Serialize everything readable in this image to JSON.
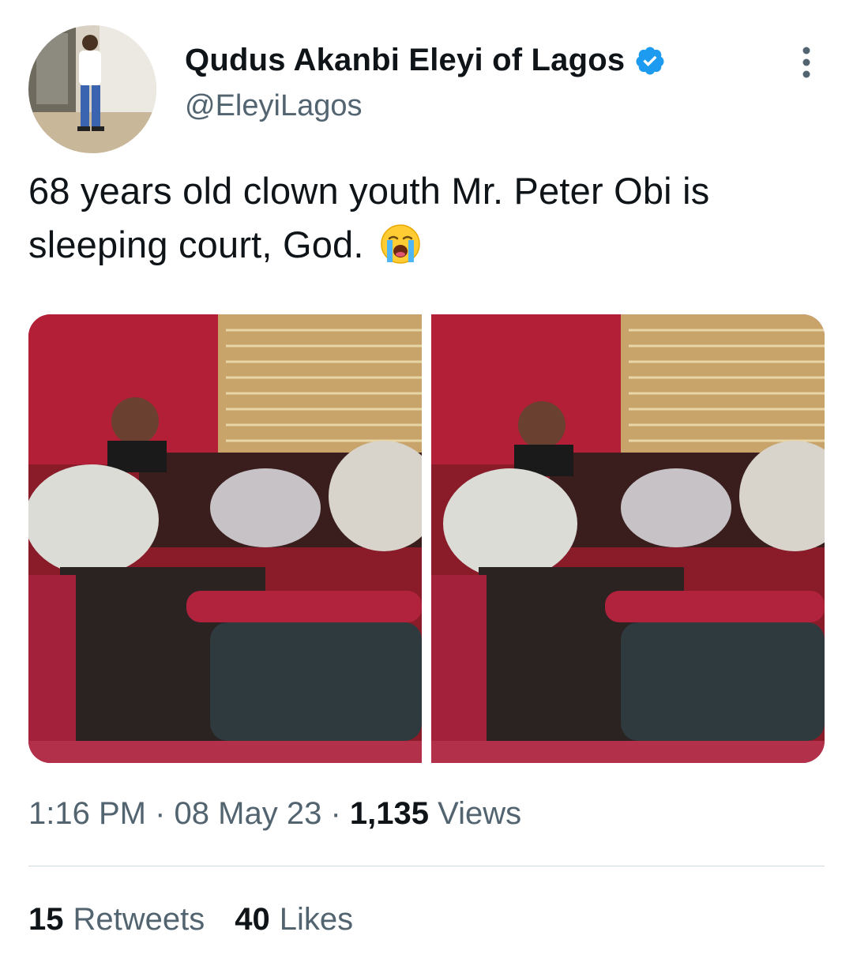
{
  "author": {
    "display_name": "Qudus Akanbi Eleyi of Lagos",
    "handle": "@EleyiLagos",
    "verified_icon": "verified-badge-icon",
    "avatar_icon": "profile-photo"
  },
  "tweet": {
    "text": "68 years old clown youth Mr. Peter Obi is sleeping court, God.",
    "emoji": "loudly-crying-face-icon"
  },
  "media": {
    "photos": [
      "courtroom-photo-1",
      "courtroom-photo-2"
    ]
  },
  "meta": {
    "time": "1:16 PM",
    "separator": "·",
    "date": "08 May 23",
    "views_count": "1,135",
    "views_label": "Views"
  },
  "stats": {
    "retweets_count": "15",
    "retweets_label": "Retweets",
    "likes_count": "40",
    "likes_label": "Likes"
  },
  "colors": {
    "text_primary": "#0f1419",
    "text_secondary": "#536471",
    "verified_blue": "#1d9bf0",
    "divider": "#cfd9de"
  }
}
